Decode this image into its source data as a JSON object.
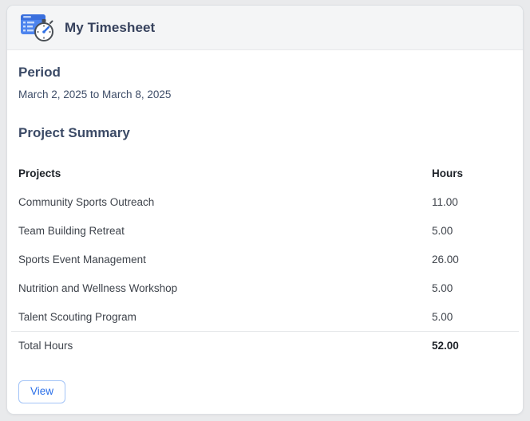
{
  "colors": {
    "accent_blue": "#2a6fe8",
    "button_border": "#a3c4f7",
    "title_navy": "#36415c",
    "heading_navy": "#3b4a66",
    "page_background": "#e9eaec",
    "header_band": "#f4f5f6",
    "icon_blue": "#4d84ee"
  },
  "header": {
    "title": "My Timesheet",
    "icon": "timesheet-clock-icon"
  },
  "period": {
    "heading": "Period",
    "value": "March 2, 2025 to March 8, 2025"
  },
  "summary": {
    "heading": "Project Summary",
    "columns": [
      "Projects",
      "Hours"
    ],
    "rows": [
      {
        "project": "Community Sports Outreach",
        "hours": "11.00"
      },
      {
        "project": "Team Building Retreat",
        "hours": "5.00"
      },
      {
        "project": "Sports Event Management",
        "hours": "26.00"
      },
      {
        "project": "Nutrition and Wellness Workshop",
        "hours": "5.00"
      },
      {
        "project": "Talent Scouting Program",
        "hours": "5.00"
      }
    ],
    "total": {
      "label": "Total Hours",
      "hours": "52.00"
    }
  },
  "actions": {
    "view_label": "View"
  }
}
